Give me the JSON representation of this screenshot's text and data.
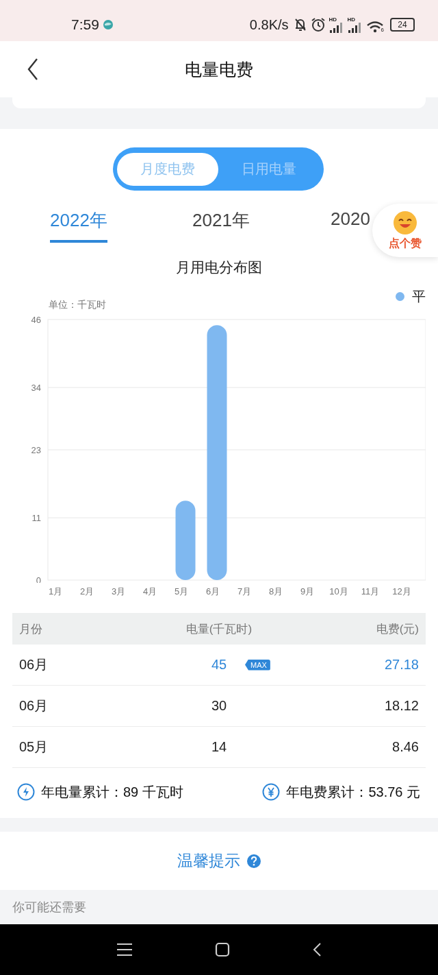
{
  "status_bar": {
    "time": "7:59",
    "net_speed": "0.8K/s",
    "signal_labels": [
      "HD",
      "HD"
    ],
    "wifi_label": "6",
    "battery": "24"
  },
  "header": {
    "title": "电量电费"
  },
  "mode_tabs": [
    {
      "label": "月度电费",
      "selected": true
    },
    {
      "label": "日用电量",
      "selected": false
    }
  ],
  "year_tabs": [
    {
      "label": "2022年",
      "selected": true
    },
    {
      "label": "2021年",
      "selected": false
    },
    {
      "label": "2020",
      "selected": false
    }
  ],
  "like_badge": {
    "label": "点个赞"
  },
  "chart": {
    "title": "月用电分布图",
    "unit": "单位：千瓦时",
    "chart_data": {
      "type": "bar",
      "categories": [
        "1月",
        "2月",
        "3月",
        "4月",
        "5月",
        "6月",
        "7月",
        "8月",
        "9月",
        "10月",
        "11月",
        "12月"
      ],
      "series": [
        {
          "name": "平",
          "color": "#7fb8f0",
          "values": [
            null,
            null,
            null,
            null,
            14,
            45,
            null,
            null,
            null,
            null,
            null,
            null
          ]
        }
      ],
      "grid": true,
      "ylim": [
        0,
        46
      ],
      "yticks": [
        0,
        11,
        23,
        34,
        46
      ]
    }
  },
  "table": {
    "columns": [
      "月份",
      "电量(千瓦时)",
      "电费(元)"
    ],
    "rows": [
      {
        "month": "06月",
        "usage": "45",
        "fee": "27.18",
        "max": true,
        "badge": "MAX"
      },
      {
        "month": "06月",
        "usage": "30",
        "fee": "18.12",
        "max": false
      },
      {
        "month": "05月",
        "usage": "14",
        "fee": "8.46",
        "max": false
      }
    ]
  },
  "totals": [
    {
      "kind": "energy",
      "label": "年电量累计：89 千瓦时"
    },
    {
      "kind": "money",
      "label": "年电费累计：53.76 元"
    }
  ],
  "tips": {
    "label": "温馨提示"
  },
  "more": {
    "label": "你可能还需要"
  }
}
